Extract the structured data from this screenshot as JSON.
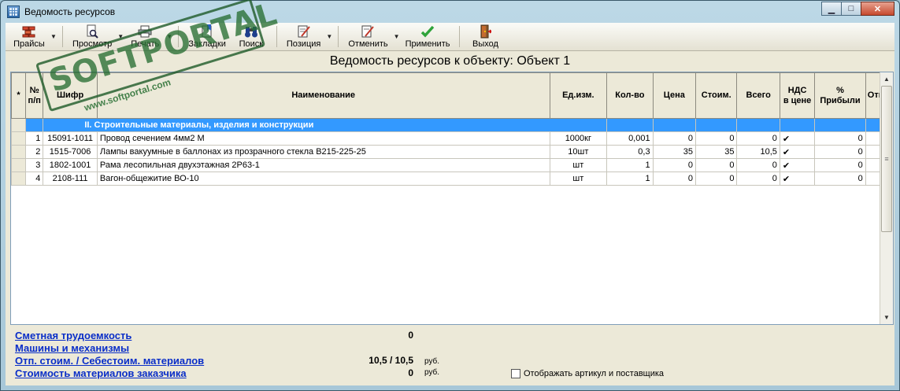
{
  "window": {
    "title": "Ведомость ресурсов",
    "minimize": "▁",
    "maximize": "□",
    "close": "✕"
  },
  "toolbar": {
    "prices": "Прайсы",
    "preview": "Просмотр",
    "print": "Печать",
    "bookmarks": "Закладки",
    "search": "Поиск",
    "position": "Позиция",
    "undo": "Отменить",
    "apply": "Применить",
    "exit": "Выход"
  },
  "report_title": "Ведомость ресурсов к объекту:  Объект 1",
  "table": {
    "headers": {
      "marker": "*",
      "num": "№\nп/п",
      "code": "Шифр",
      "name": "Наименование",
      "unit": "Ед.изм.",
      "qty": "Кол-во",
      "price": "Цена",
      "cost": "Стоим.",
      "total": "Всего",
      "vat": "НДС\nв цене",
      "profit": "%\nПрибыли",
      "extra": "Отп"
    },
    "group_label": "II. Строительные материалы, изделия и конструкции",
    "rows": [
      {
        "num": "1",
        "code": "15091-1011",
        "name": "Провод сечением 4мм2 М",
        "unit": "1000кг",
        "qty": "0,001",
        "price": "0",
        "cost": "0",
        "total": "0",
        "vat": "✔",
        "profit": "0"
      },
      {
        "num": "2",
        "code": "1515-7006",
        "name": "Лампы вакуумные в баллонах из прозрачного стекла B215-225-25",
        "unit": "10шт",
        "qty": "0,3",
        "price": "35",
        "cost": "35",
        "total": "10,5",
        "vat": "✔",
        "profit": "0"
      },
      {
        "num": "3",
        "code": "1802-1001",
        "name": "Рама лесопильная двухэтажная 2Р63-1",
        "unit": "шт",
        "qty": "1",
        "price": "0",
        "cost": "0",
        "total": "0",
        "vat": "✔",
        "profit": "0"
      },
      {
        "num": "4",
        "code": "2108-111",
        "name": "Вагон-общежитие ВО-10",
        "unit": "шт",
        "qty": "1",
        "price": "0",
        "cost": "0",
        "total": "0",
        "vat": "✔",
        "profit": "0"
      }
    ]
  },
  "footer": {
    "labor_label": "Сметная трудоемкость",
    "labor_value": "0",
    "machines_label": "Машины и механизмы",
    "materials_label": "Отп. стоим. / Себестоим. материалов",
    "materials_value": "10,5 / 10,5",
    "materials_unit": "руб.",
    "customer_label": "Стоимость материалов заказчика",
    "customer_value": "0",
    "customer_unit": "руб.",
    "show_article_label": "Отображать артикул и поставщика"
  },
  "watermark": {
    "big": "SOFTPORTAL",
    "small": "www.softportal.com"
  }
}
